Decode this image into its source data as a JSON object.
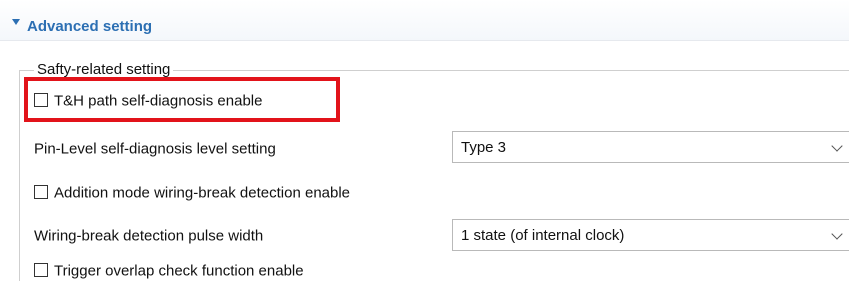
{
  "section": {
    "title": "Advanced setting",
    "toggle_icon": "caret-down-icon",
    "accent_color": "#2c6fb3"
  },
  "group": {
    "legend": "Safty-related setting"
  },
  "options": {
    "th_path_diag": {
      "label": "T&H path self-diagnosis enable",
      "checked": false,
      "highlighted": true,
      "highlight_color": "#e2131a"
    },
    "pin_level_diag": {
      "label": "Pin-Level self-diagnosis level setting",
      "value": "Type 3"
    },
    "addition_mode_wiring": {
      "label": "Addition mode wiring-break detection enable",
      "checked": false
    },
    "wiring_break_pulse": {
      "label": "Wiring-break detection pulse width",
      "value": "1 state (of internal clock)"
    },
    "trigger_overlap": {
      "label": "Trigger overlap check function enable",
      "checked": false
    }
  }
}
